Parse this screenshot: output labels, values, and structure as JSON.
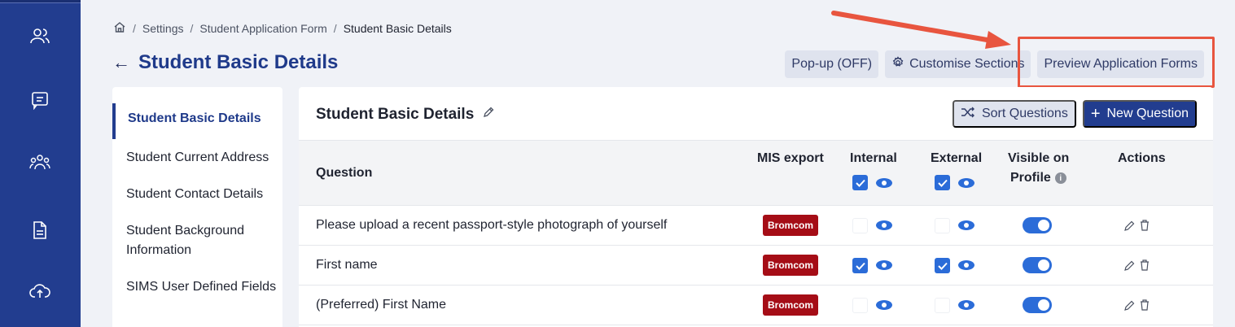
{
  "breadcrumb": {
    "home_icon": "home-icon",
    "items": [
      "Settings",
      "Student Application Form"
    ],
    "current": "Student Basic Details"
  },
  "page": {
    "title": "Student Basic Details",
    "back_icon": "arrow-left-icon"
  },
  "top_actions": {
    "popup": "Pop-up (OFF)",
    "customise": "Customise Sections",
    "preview": "Preview Application Forms"
  },
  "rail": {
    "icons": [
      "people-icon",
      "chat-icon",
      "group-icon",
      "document-icon",
      "cloud-upload-icon"
    ]
  },
  "left_nav": {
    "active": "Student Basic Details",
    "items": [
      "Student Current Address",
      "Student Contact Details",
      "Student Background Information",
      "SIMS User Defined Fields"
    ]
  },
  "card": {
    "title": "Student Basic Details",
    "sort_label": "Sort Questions",
    "new_label": "New Question"
  },
  "table": {
    "headers": {
      "question": "Question",
      "mis": "MIS export",
      "internal": "Internal",
      "external": "External",
      "visible1": "Visible on",
      "visible2": "Profile",
      "actions": "Actions"
    },
    "rows": [
      {
        "question": "Please upload a recent passport-style photograph of yourself",
        "mis": "Bromcom",
        "internal_checked": false,
        "external_checked": false,
        "visible": true
      },
      {
        "question": "First name",
        "mis": "Bromcom",
        "internal_checked": true,
        "external_checked": true,
        "visible": true
      },
      {
        "question": "(Preferred) First Name",
        "mis": "Bromcom",
        "internal_checked": false,
        "external_checked": false,
        "visible": true
      }
    ]
  },
  "colors": {
    "primary": "#223d8f",
    "accent": "#2b6cd8",
    "badge": "#a50d16",
    "highlight": "#e8553f"
  }
}
